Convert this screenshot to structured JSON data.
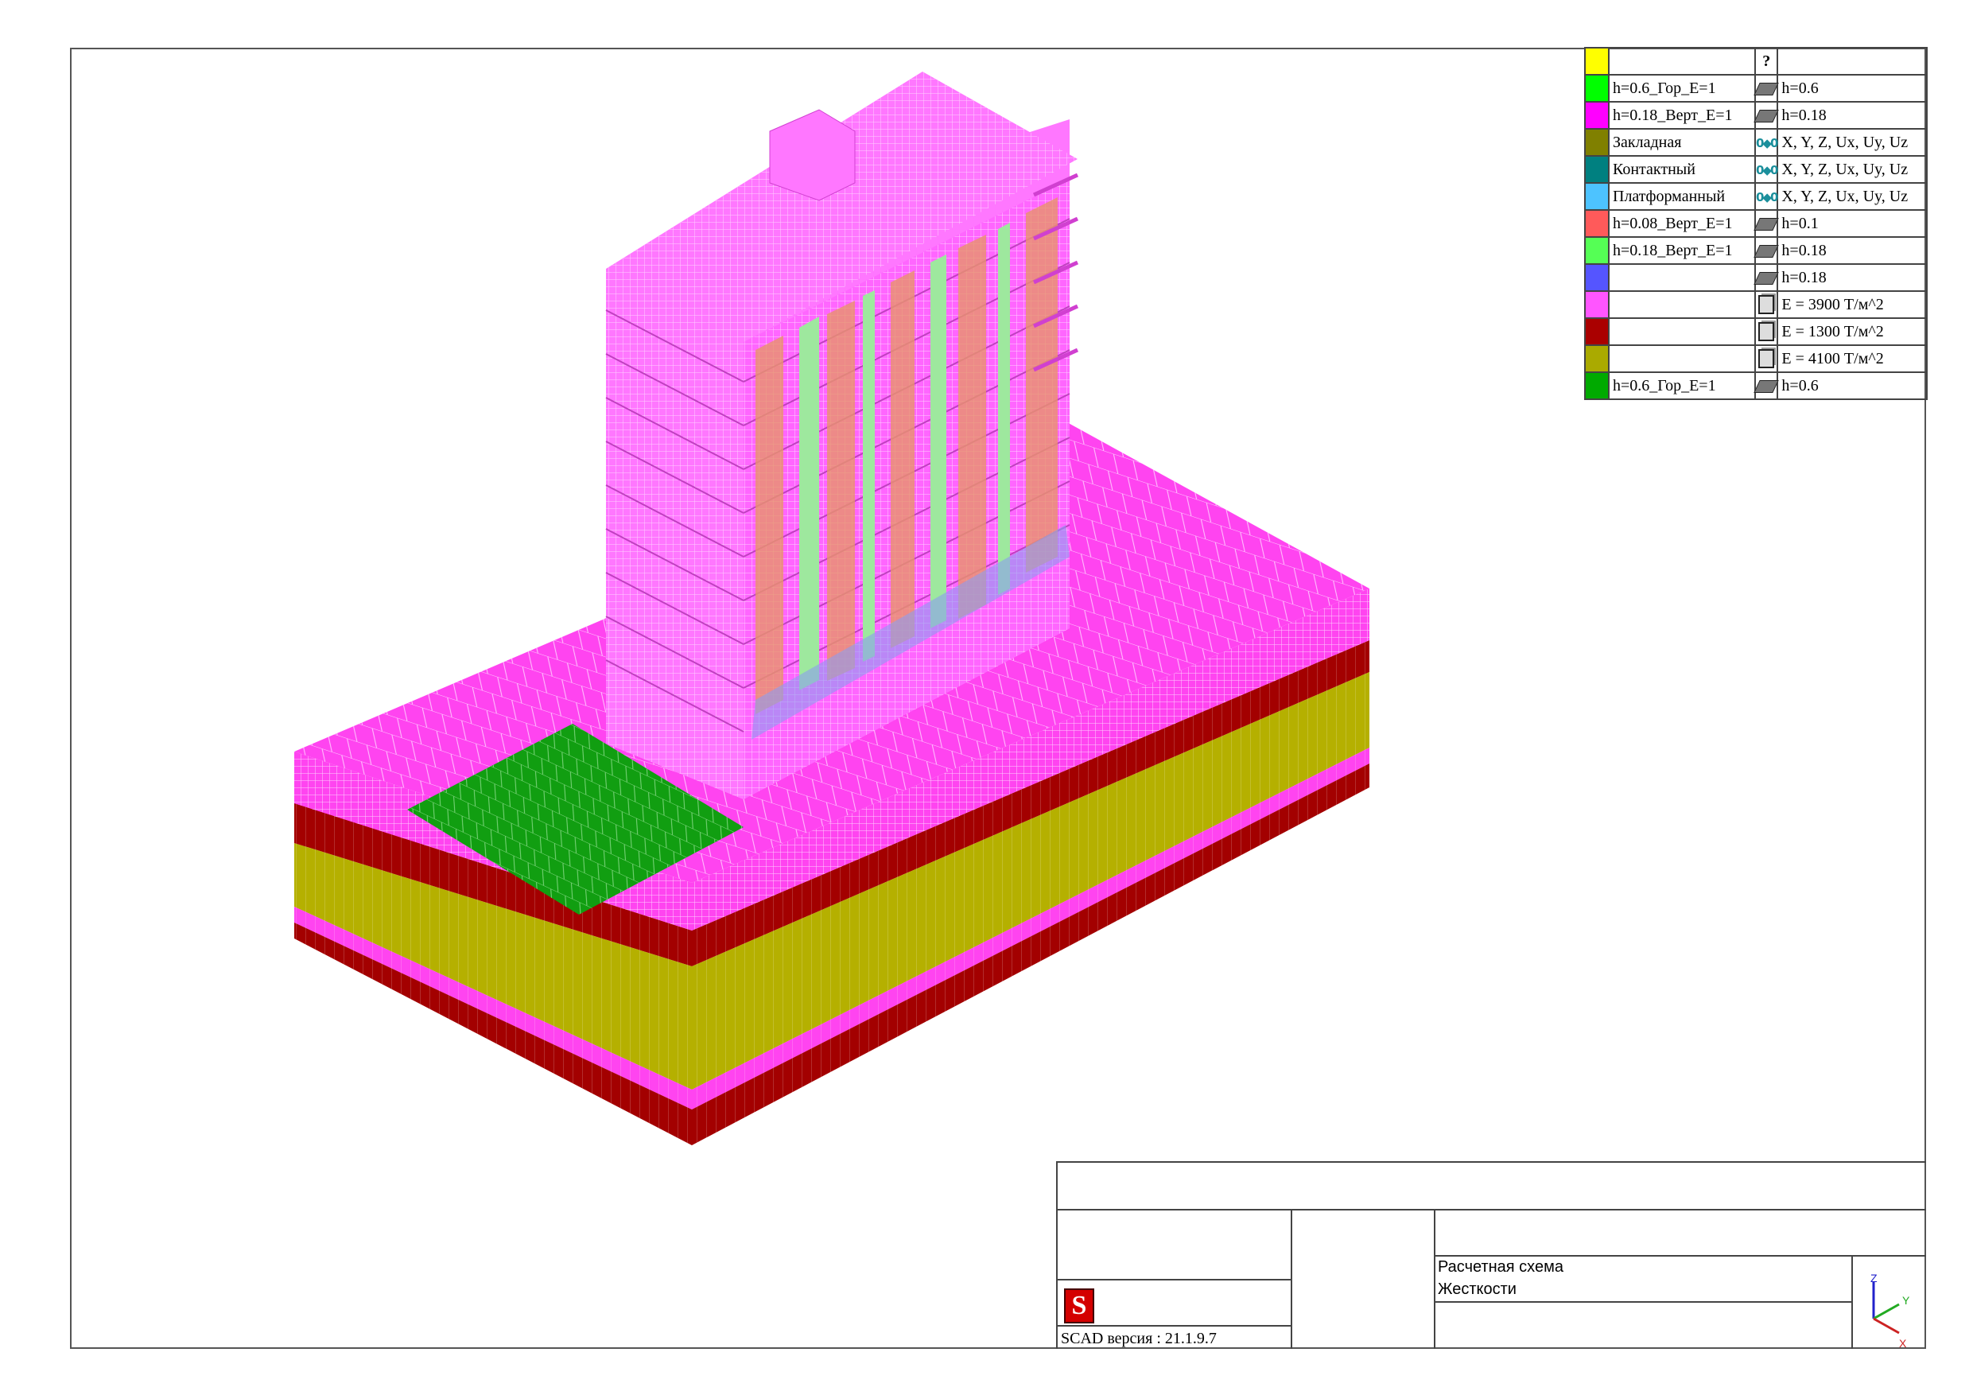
{
  "legend": {
    "header_icon": "?",
    "rows": [
      {
        "color": "#ffff00",
        "name": "",
        "icon": "none",
        "value": ""
      },
      {
        "color": "#00ff00",
        "name": "h=0.6_Гор_E=1",
        "icon": "shell-icon",
        "value": "h=0.6"
      },
      {
        "color": "#ff00ff",
        "name": "h=0.18_Верт_E=1",
        "icon": "shell-icon",
        "value": "h=0.18"
      },
      {
        "color": "#808000",
        "name": "Закладная",
        "icon": "link-icon",
        "value": "X, Y, Z, Ux, Uy, Uz"
      },
      {
        "color": "#008080",
        "name": "Контактный",
        "icon": "link-icon",
        "value": "X, Y, Z, Ux, Uy, Uz"
      },
      {
        "color": "#4dc3ff",
        "name": "Платформанный",
        "icon": "link-icon",
        "value": "X, Y, Z, Ux, Uy, Uz"
      },
      {
        "color": "#ff5a5a",
        "name": "h=0.08_Верт_E=1",
        "icon": "shell-icon",
        "value": "h=0.1"
      },
      {
        "color": "#55ff55",
        "name": "h=0.18_Верт_E=1",
        "icon": "shell-icon",
        "value": "h=0.18"
      },
      {
        "color": "#5555ff",
        "name": "",
        "icon": "shell-icon",
        "value": "h=0.18"
      },
      {
        "color": "#ff55ff",
        "name": "",
        "icon": "solid-icon",
        "value": "E = 3900 Т/м^2"
      },
      {
        "color": "#aa0000",
        "name": "",
        "icon": "solid-icon",
        "value": "E = 1300 Т/м^2"
      },
      {
        "color": "#aaaa00",
        "name": "",
        "icon": "solid-icon",
        "value": "E = 4100 Т/м^2"
      },
      {
        "color": "#00aa00",
        "name": "h=0.6_Гор_E=1",
        "icon": "shell-icon",
        "value": "h=0.6"
      }
    ]
  },
  "title_block": {
    "scheme_line1": "Расчетная схема",
    "scheme_line2": "Жесткости",
    "version": "SCAD версия : 21.1.9.7",
    "logo_letter": "S"
  },
  "axes": {
    "z": "Z",
    "y": "Y",
    "x": "X"
  },
  "colors": {
    "slab_magenta": "#ff44f0",
    "building_magenta": "#ff77ff",
    "soil_dark_red": "#a30000",
    "soil_olive": "#b5b000",
    "foundation_green": "#119e11",
    "window_orange": "#e8946a",
    "wall_green": "#9ee89e",
    "link_blue": "#8c9cf0"
  }
}
